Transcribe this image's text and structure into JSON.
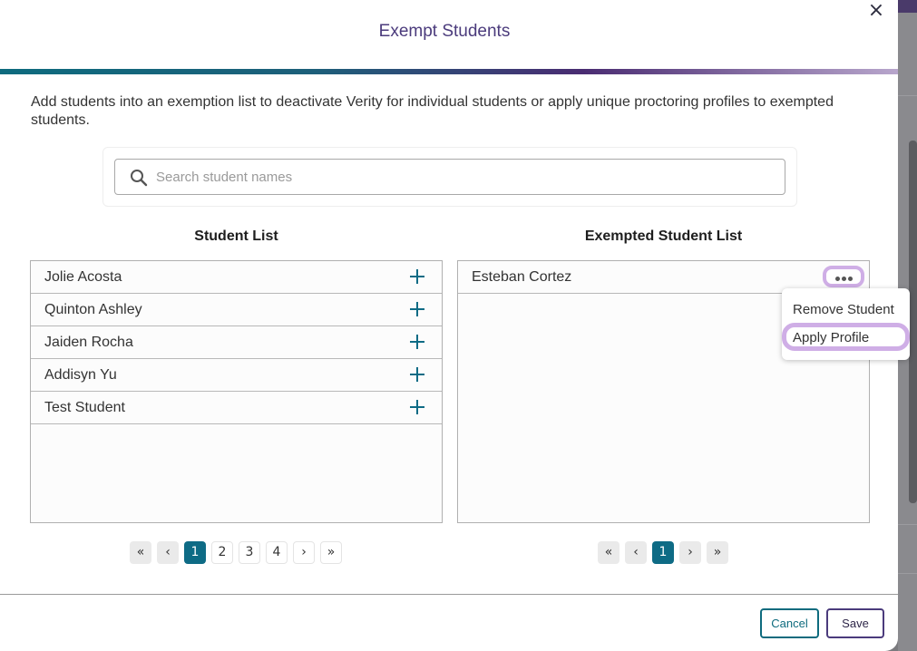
{
  "modal": {
    "title": "Exempt Students",
    "close_label": "×",
    "description": "Add students into an exemption list to deactivate Verity for individual students or apply unique proctoring profiles to exempted students."
  },
  "search": {
    "placeholder": "Search student names",
    "value": ""
  },
  "student_list": {
    "title": "Student List",
    "items": [
      "Jolie Acosta",
      "Quinton Ashley",
      "Jaiden Rocha",
      "Addisyn Yu",
      "Test Student"
    ],
    "pagination": {
      "first": "«",
      "prev": "‹",
      "next": "›",
      "last": "»",
      "pages": [
        "1",
        "2",
        "3",
        "4"
      ],
      "current": "1"
    }
  },
  "exempted_list": {
    "title": "Exempted Student List",
    "items": [
      "Esteban Cortez"
    ],
    "pagination": {
      "first": "«",
      "prev": "‹",
      "next": "›",
      "last": "»",
      "pages": [
        "1"
      ],
      "current": "1"
    }
  },
  "context_menu": {
    "items": [
      "Remove Student",
      "Apply Profile"
    ]
  },
  "footer": {
    "cancel_label": "Cancel",
    "save_label": "Save"
  },
  "colors": {
    "accent_teal": "#0e6b85",
    "accent_purple": "#4b3b7c",
    "highlight": "#cfaee6"
  },
  "icons": [
    "close-icon",
    "search-icon",
    "plus-icon",
    "more-horizontal-icon",
    "double-chevron-left-icon",
    "chevron-left-icon",
    "chevron-right-icon",
    "double-chevron-right-icon"
  ]
}
